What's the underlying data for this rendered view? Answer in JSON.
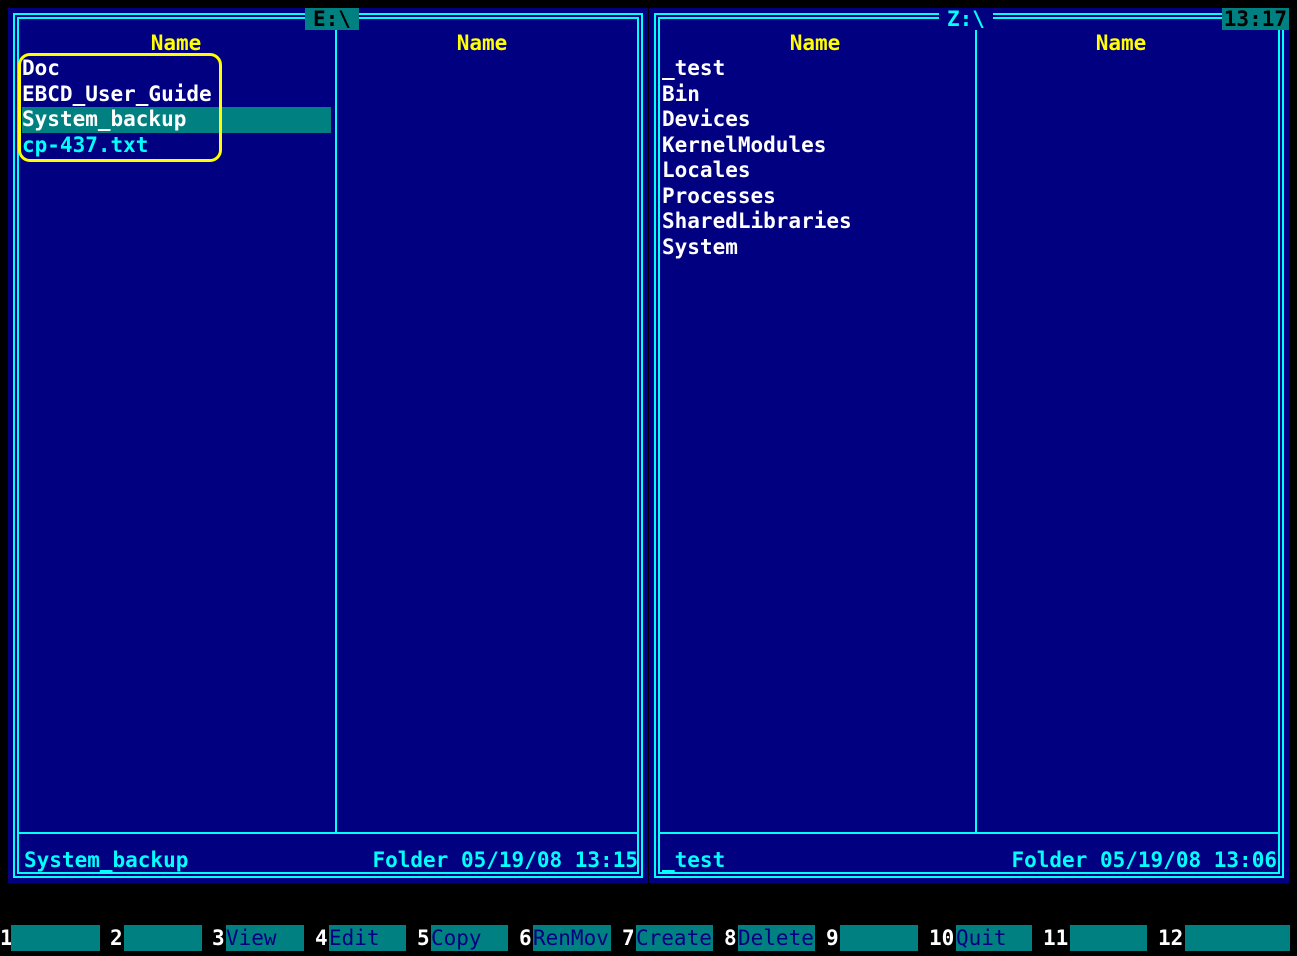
{
  "clock": "13:17",
  "left_panel": {
    "path": "E:\\",
    "col1_header": "Name",
    "col2_header": "Name",
    "items": [
      {
        "name": "Doc",
        "type": "folder"
      },
      {
        "name": "EBCD_User_Guide",
        "type": "folder"
      },
      {
        "name": "System_backup",
        "type": "folder",
        "selected": true
      },
      {
        "name": "cp-437.txt",
        "type": "file"
      }
    ],
    "status_name": "System_backup",
    "status_info": "Folder 05/19/08 13:15"
  },
  "right_panel": {
    "path": "Z:\\",
    "col1_header": "Name",
    "col2_header": "Name",
    "items": [
      {
        "name": "_test",
        "type": "folder"
      },
      {
        "name": "Bin",
        "type": "folder"
      },
      {
        "name": "Devices",
        "type": "folder"
      },
      {
        "name": "KernelModules",
        "type": "folder"
      },
      {
        "name": "Locales",
        "type": "folder"
      },
      {
        "name": "Processes",
        "type": "folder"
      },
      {
        "name": "SharedLibraries",
        "type": "folder"
      },
      {
        "name": "System",
        "type": "folder"
      }
    ],
    "status_name": "_test",
    "status_info": "Folder 05/19/08 13:06"
  },
  "function_keys": [
    {
      "num": "1",
      "label": ""
    },
    {
      "num": "2",
      "label": ""
    },
    {
      "num": "3",
      "label": "View"
    },
    {
      "num": "4",
      "label": "Edit"
    },
    {
      "num": "5",
      "label": "Copy"
    },
    {
      "num": "6",
      "label": "RenMov"
    },
    {
      "num": "7",
      "label": "Create"
    },
    {
      "num": "8",
      "label": "Delete"
    },
    {
      "num": "9",
      "label": ""
    },
    {
      "num": "10",
      "label": "Quit"
    },
    {
      "num": "11",
      "label": ""
    },
    {
      "num": "12",
      "label": ""
    }
  ],
  "colors": {
    "panel_bg": "#000080",
    "border": "#00ffff",
    "header": "#ffff00",
    "selection": "#008080",
    "annotation": "#ffff00"
  }
}
